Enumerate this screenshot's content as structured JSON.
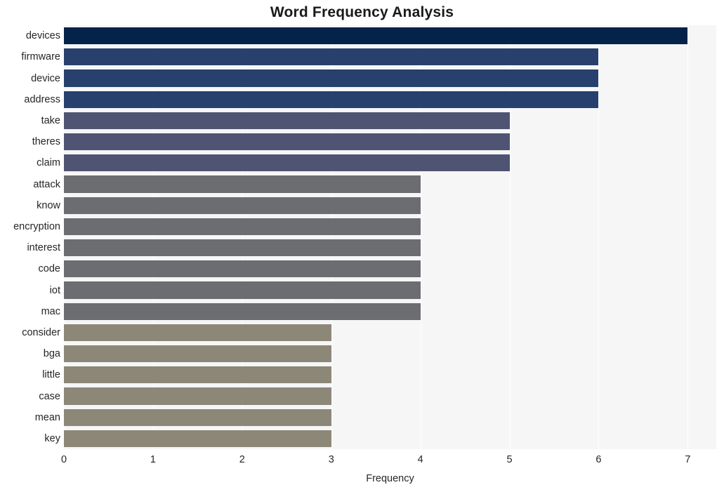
{
  "chart_data": {
    "type": "bar",
    "orientation": "horizontal",
    "title": "Word Frequency Analysis",
    "xlabel": "Frequency",
    "ylabel": "",
    "xlim": [
      0,
      7.32
    ],
    "xticks": [
      0,
      1,
      2,
      3,
      4,
      5,
      6,
      7
    ],
    "xtick_labels": [
      "0",
      "1",
      "2",
      "3",
      "4",
      "5",
      "6",
      "7"
    ],
    "grid": "vertical-white-gridlines",
    "legend": "none",
    "background": "#f6f6f7",
    "categories": [
      "devices",
      "firmware",
      "device",
      "address",
      "take",
      "theres",
      "claim",
      "attack",
      "know",
      "encryption",
      "interest",
      "code",
      "iot",
      "mac",
      "consider",
      "bga",
      "little",
      "case",
      "mean",
      "key"
    ],
    "values": [
      7,
      6,
      6,
      6,
      5,
      5,
      5,
      4,
      4,
      4,
      4,
      4,
      4,
      4,
      3,
      3,
      3,
      3,
      3,
      3
    ],
    "bar_colors": [
      "#04234b",
      "#27406e",
      "#27406e",
      "#27406e",
      "#4e5472",
      "#4e5472",
      "#4e5472",
      "#6b6d71",
      "#6b6d71",
      "#6b6d71",
      "#6b6d71",
      "#6b6d71",
      "#6b6d71",
      "#6b6d71",
      "#8c8777",
      "#8c8777",
      "#8c8777",
      "#8c8777",
      "#8c8777",
      "#8c8777"
    ]
  },
  "colors": {
    "title_text": "#1a1a1a",
    "axis_text": "#262626",
    "plot_background": "#f6f6f7",
    "gridline": "#ffffff",
    "figure_background": "#ffffff"
  }
}
